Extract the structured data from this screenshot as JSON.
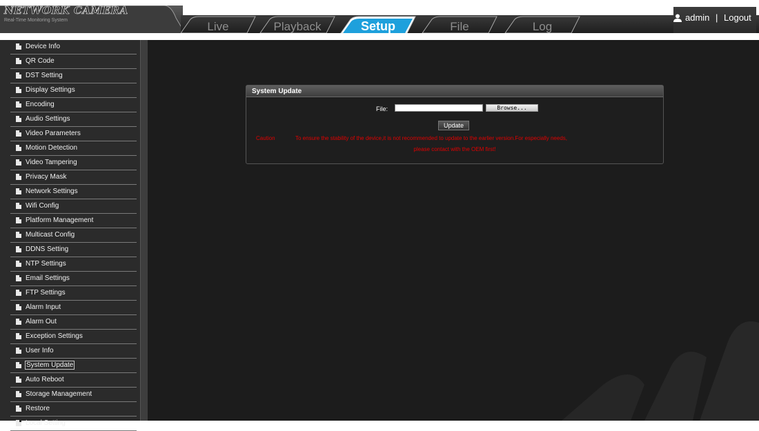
{
  "app": {
    "title": "NETWORK CAMERA",
    "subtitle": "Real-Time Monitoring System"
  },
  "tabs": [
    {
      "label": "Live",
      "active": false
    },
    {
      "label": "Playback",
      "active": false
    },
    {
      "label": "Setup",
      "active": true
    },
    {
      "label": "File",
      "active": false
    },
    {
      "label": "Log",
      "active": false
    }
  ],
  "user": {
    "icon": "user-icon",
    "name": "admin",
    "separator": "|",
    "logout_label": "Logout"
  },
  "sidebar": {
    "items": [
      {
        "label": "Device Info",
        "icon": "page-icon"
      },
      {
        "label": "QR Code",
        "icon": "page-icon"
      },
      {
        "label": "DST Setting",
        "icon": "page-icon"
      },
      {
        "label": "Display Settings",
        "icon": "page-icon"
      },
      {
        "label": "Encoding",
        "icon": "page-icon"
      },
      {
        "label": "Audio Settings",
        "icon": "page-icon"
      },
      {
        "label": "Video Parameters",
        "icon": "page-icon"
      },
      {
        "label": "Motion Detection",
        "icon": "page-icon"
      },
      {
        "label": "Video Tampering",
        "icon": "page-icon"
      },
      {
        "label": "Privacy Mask",
        "icon": "page-icon"
      },
      {
        "label": "Network Settings",
        "icon": "page-icon"
      },
      {
        "label": "Wifi Config",
        "icon": "page-icon"
      },
      {
        "label": "Platform Management",
        "icon": "page-icon"
      },
      {
        "label": "Multicast Config",
        "icon": "page-icon"
      },
      {
        "label": "DDNS Setting",
        "icon": "page-icon"
      },
      {
        "label": "NTP Settings",
        "icon": "page-icon"
      },
      {
        "label": "Email Settings",
        "icon": "page-icon"
      },
      {
        "label": "FTP Settings",
        "icon": "page-icon"
      },
      {
        "label": "Alarm Input",
        "icon": "page-icon"
      },
      {
        "label": "Alarm Out",
        "icon": "page-icon"
      },
      {
        "label": "Exception Settings",
        "icon": "page-icon"
      },
      {
        "label": "User Info",
        "icon": "page-icon"
      },
      {
        "label": "System Update",
        "icon": "page-icon",
        "active": true
      },
      {
        "label": "Auto Reboot",
        "icon": "page-icon"
      },
      {
        "label": "Storage Management",
        "icon": "page-icon"
      },
      {
        "label": "Restore",
        "icon": "page-icon"
      },
      {
        "label": "Local Setting",
        "icon": "page-icon"
      }
    ]
  },
  "update_panel": {
    "title": "System Update",
    "file_label": "File:",
    "file_value": "",
    "browse_label": "Browse...",
    "update_label": "Update",
    "caution_label": "Caution",
    "caution_line1": "To ensure the stability of the device,it is not recommended to update to the earlier version.For especially needs,",
    "caution_line2": "please contact with the OEM first!"
  },
  "colors": {
    "background": "#1c1c1c",
    "sidebar": "#2b2b2b",
    "active_tab": "#1ea0dc",
    "warning_text": "#e00000"
  }
}
